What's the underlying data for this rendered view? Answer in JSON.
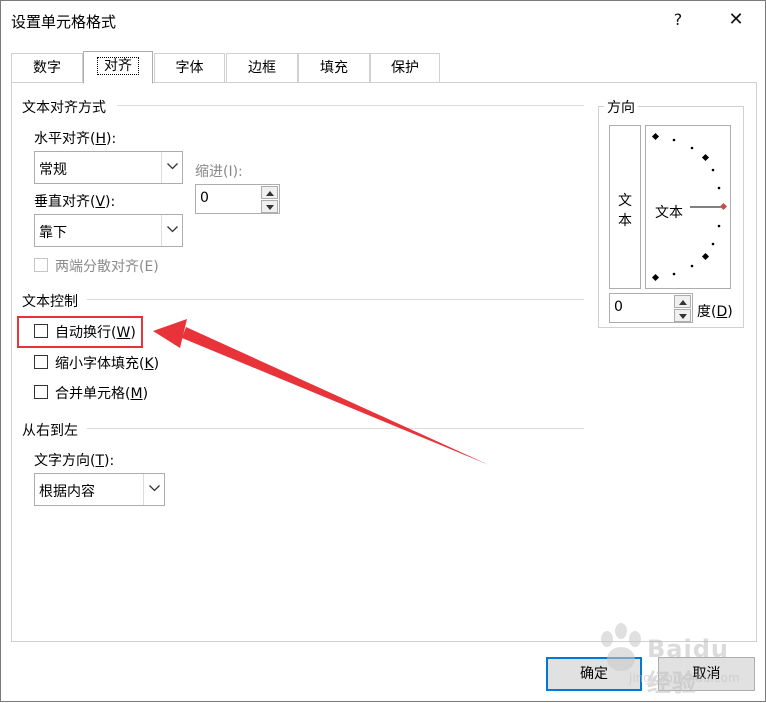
{
  "window": {
    "title": "设置单元格格式",
    "help": "?",
    "close": "✕"
  },
  "tabs": [
    {
      "label": "数字"
    },
    {
      "label": "对齐"
    },
    {
      "label": "字体"
    },
    {
      "label": "边框"
    },
    {
      "label": "填充"
    },
    {
      "label": "保护"
    }
  ],
  "active_tab": "对齐",
  "text_alignment": {
    "group": "文本对齐方式",
    "horizontal_label": "水平对齐(",
    "horizontal_key": "H",
    "horizontal_tail": "):",
    "horizontal_value": "常规",
    "indent_label": "缩进(I):",
    "indent_value": "0",
    "vertical_label": "垂直对齐(",
    "vertical_key": "V",
    "vertical_tail": "):",
    "vertical_value": "靠下",
    "justify_distributed": "两端分散对齐(E)",
    "justify_distributed_checked": false
  },
  "text_control": {
    "group": "文本控制",
    "wrap_text_label": "自动换行(",
    "wrap_text_key": "W",
    "wrap_text_tail": ")",
    "wrap_text_checked": false,
    "shrink_label": "缩小字体填充(",
    "shrink_key": "K",
    "shrink_tail": ")",
    "shrink_checked": false,
    "merge_label": "合并单元格(",
    "merge_key": "M",
    "merge_tail": ")",
    "merge_checked": false
  },
  "rtl": {
    "group": "从右到左",
    "direction_label": "文字方向(",
    "direction_key": "T",
    "direction_tail": "):",
    "direction_value": "根据内容"
  },
  "orientation": {
    "group": "方向",
    "vertical_char_1": "文",
    "vertical_char_2": "本",
    "dial_text": "文本",
    "degrees_value": "0",
    "degrees_label": "度(",
    "degrees_key": "D",
    "degrees_tail": ")",
    "degrees": 0
  },
  "footer": {
    "ok": "确定",
    "cancel": "取消"
  },
  "watermark": {
    "text": "Baidu 经验",
    "sub": "jingyan.baidu.com"
  },
  "colors": {
    "accent": "#0078d7",
    "annotation": "#e8333a",
    "dial_marker": "#c0504d"
  }
}
